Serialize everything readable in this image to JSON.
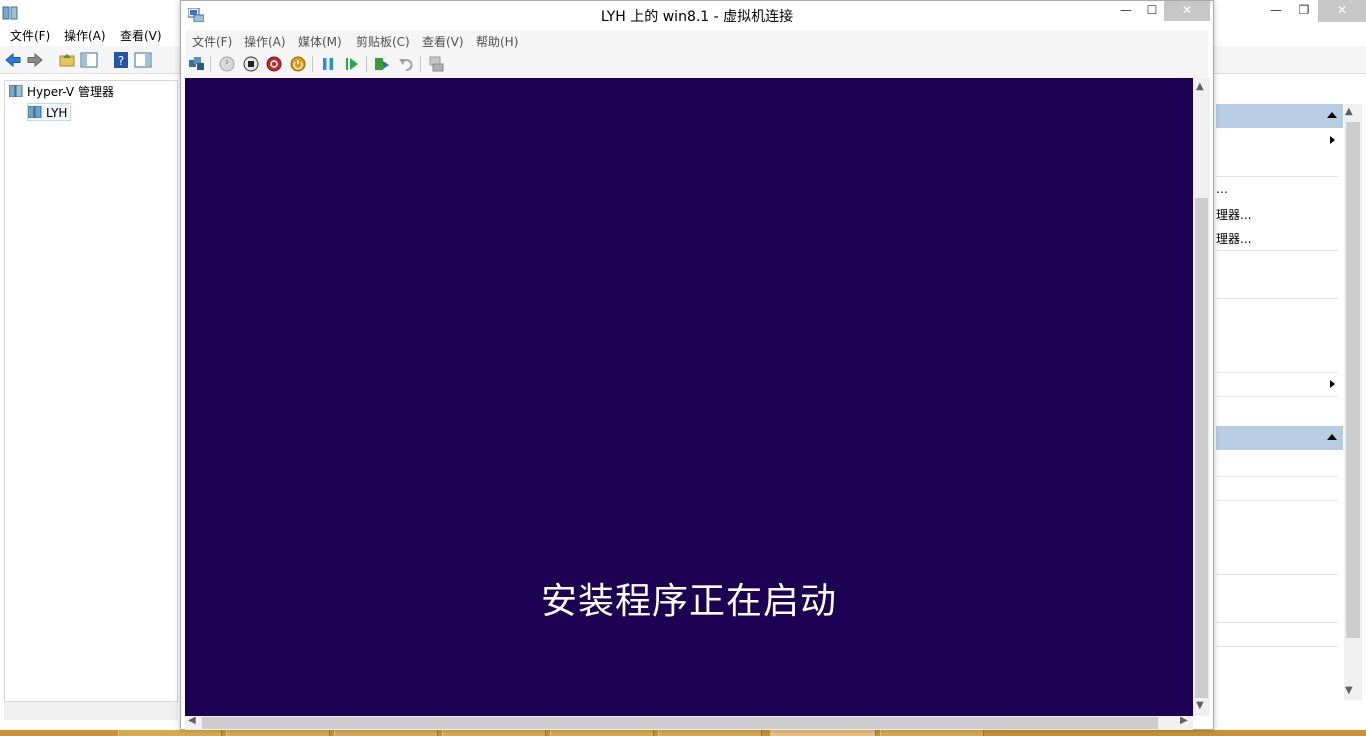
{
  "background_app": {
    "menu": [
      "文件(F)",
      "操作(A)",
      "查看(V)"
    ],
    "window_buttons": {
      "minimize": "—",
      "maximize": "❐",
      "close": "✕"
    },
    "tree": {
      "root": "Hyper-V 管理器",
      "child": "LYH"
    },
    "actions_partial": [
      "…",
      "理器...",
      "理器..."
    ],
    "scroll_up": "▲",
    "scroll_down": "▼"
  },
  "vm_window": {
    "title": "LYH 上的 win8.1 - 虚拟机连接",
    "window_buttons": {
      "minimize": "—",
      "maximize": "☐",
      "close": "✕"
    },
    "menu": [
      "文件(F)",
      "操作(A)",
      "媒体(M)",
      "剪贴板(C)",
      "查看(V)",
      "帮助(H)"
    ],
    "screen_text": "安装程序正在启动",
    "screen_color": "#1c0052",
    "scroll": {
      "up": "▲",
      "down": "▼",
      "left": "◀",
      "right": "▶"
    }
  },
  "colors": {
    "taskbar": "#c8933a",
    "actions_header": "#b8cce4"
  }
}
